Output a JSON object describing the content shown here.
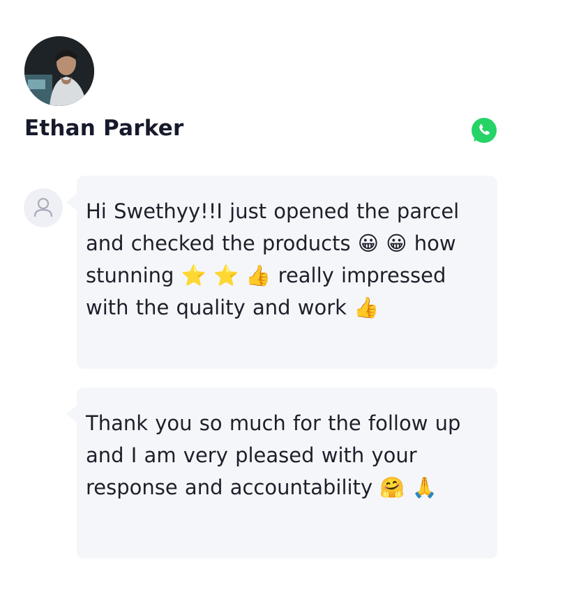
{
  "contact": {
    "name": "Ethan Parker",
    "avatar_icon": "profile-photo",
    "app_icon": "whatsapp-icon"
  },
  "colors": {
    "name_text": "#161a2b",
    "bubble_bg": "#f5f6fa",
    "whatsapp_green": "#25d366",
    "placeholder_icon": "#a7acb8"
  },
  "messages": [
    {
      "sender_icon": "user-icon",
      "text": "Hi Swethyy!!I just opened the parcel and checked the products 😀 😀 how stunning ⭐ ⭐ 👍 really impressed with the quality and work 👍"
    },
    {
      "text": "Thank you so much for the follow up and I am very pleased with your response and accountability 🤗 🙏"
    }
  ]
}
